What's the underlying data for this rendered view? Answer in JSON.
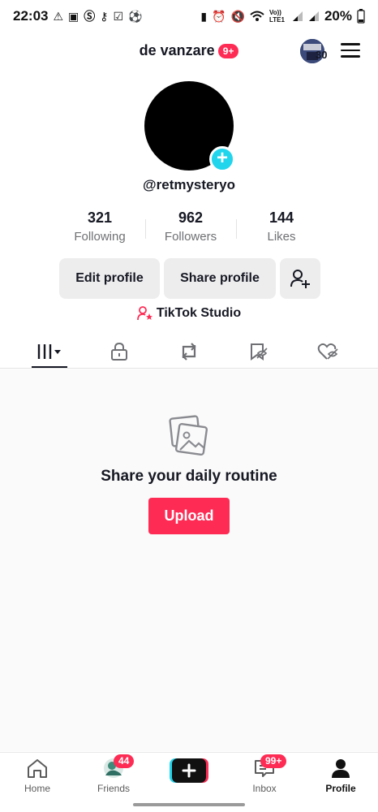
{
  "status_bar": {
    "time": "22:03",
    "battery_percent": "20%",
    "left_icons": [
      "warning-icon",
      "image-icon",
      "s-icon",
      "key-icon",
      "check-icon",
      "soccer-icon"
    ],
    "right_icons": [
      "sim-icon",
      "alarm-icon",
      "mute-icon",
      "wifi-icon",
      "volte-icon",
      "signal-icon",
      "signal-icon",
      "battery-icon"
    ],
    "volte_label": "Vo)) LTE1"
  },
  "header": {
    "title": "de vanzare",
    "title_badge": "9+",
    "avatar_count": "30"
  },
  "profile": {
    "handle": "@retmysteryo",
    "stats": [
      {
        "value": "321",
        "label": "Following"
      },
      {
        "value": "962",
        "label": "Followers"
      },
      {
        "value": "144",
        "label": "Likes"
      }
    ],
    "edit_label": "Edit profile",
    "share_label": "Share profile",
    "studio_label": "TikTok Studio"
  },
  "tabs": [
    "videos-grid-icon",
    "lock-icon",
    "repost-icon",
    "favorites-icon",
    "liked-icon"
  ],
  "empty_state": {
    "title": "Share your daily routine",
    "button_label": "Upload"
  },
  "bottom_nav": {
    "items": [
      {
        "label": "Home",
        "icon": "home-icon"
      },
      {
        "label": "Friends",
        "icon": "friends-icon",
        "badge": "44"
      },
      {
        "label": "Inbox",
        "icon": "inbox-icon",
        "badge": "99+"
      },
      {
        "label": "Profile",
        "icon": "profile-icon",
        "active": true
      }
    ]
  },
  "colors": {
    "accent": "#fe2c55",
    "teal": "#20d5ec",
    "text": "#161823",
    "muted": "#6f7074"
  }
}
